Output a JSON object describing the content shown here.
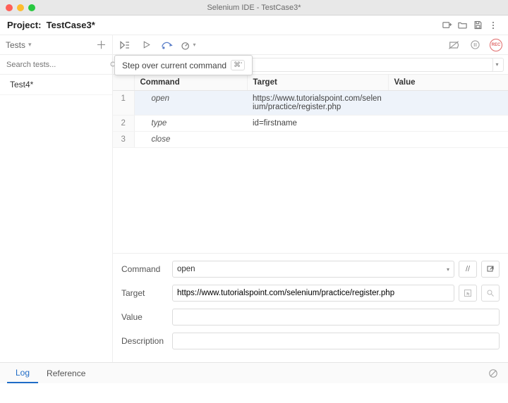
{
  "window": {
    "title": "Selenium IDE - TestCase3*"
  },
  "project": {
    "label": "Project:",
    "name": "TestCase3*"
  },
  "tests": {
    "header": "Tests",
    "search_placeholder": "Search tests...",
    "items": [
      {
        "label": "Test4*"
      }
    ]
  },
  "tooltip": {
    "text": "Step over current command",
    "shortcut": "⌘'"
  },
  "url_input": {
    "value": ""
  },
  "table": {
    "headers": {
      "command": "Command",
      "target": "Target",
      "value": "Value"
    },
    "rows": [
      {
        "n": "1",
        "command": "open",
        "target": "https://www.tutorialspoint.com/selenium/practice/register.php",
        "value": "",
        "selected": true
      },
      {
        "n": "2",
        "command": "type",
        "target": "id=firstname",
        "value": ""
      },
      {
        "n": "3",
        "command": "close",
        "target": "",
        "value": ""
      }
    ]
  },
  "form": {
    "labels": {
      "command": "Command",
      "target": "Target",
      "value": "Value",
      "description": "Description"
    },
    "command_value": "open",
    "target_value": "https://www.tutorialspoint.com/selenium/practice/register.php",
    "value_value": "",
    "description_value": ""
  },
  "bottom": {
    "log": "Log",
    "reference": "Reference"
  },
  "rec_label": "REC"
}
